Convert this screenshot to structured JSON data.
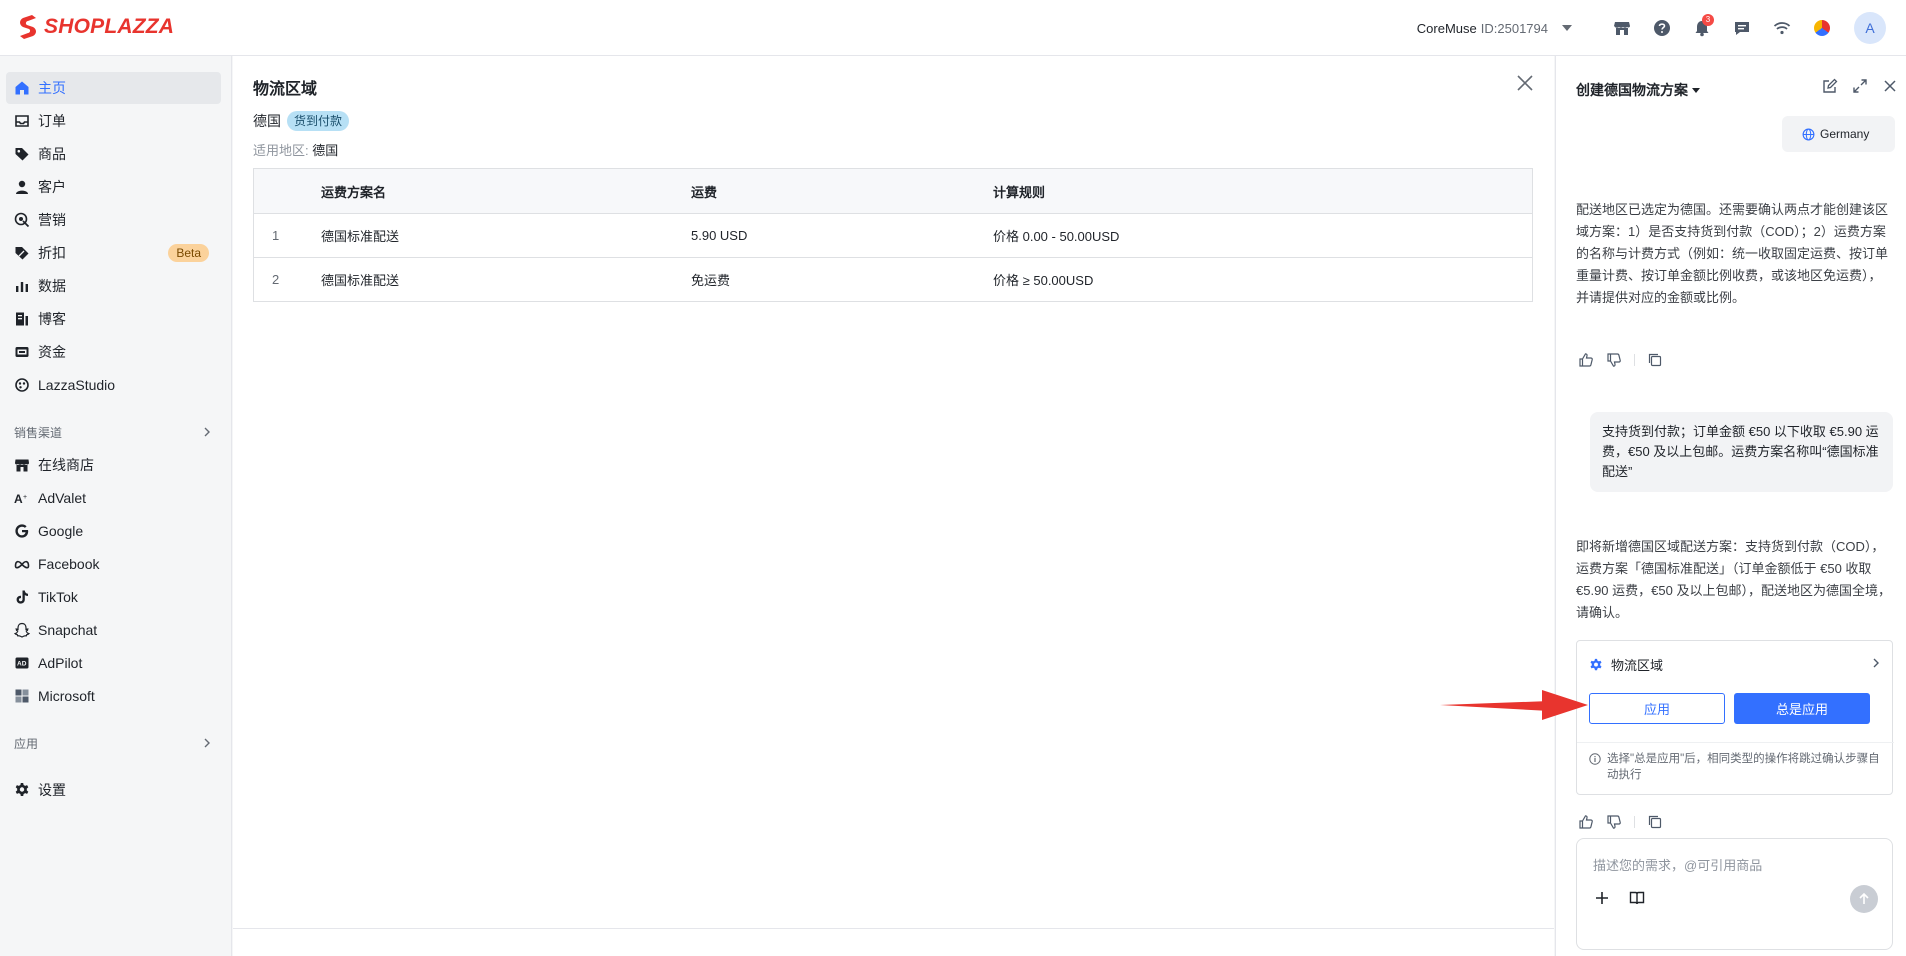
{
  "brand": {
    "logo_text": "SHOPLAZZA",
    "accent": "#3370ff",
    "brand_red": "#e8342e"
  },
  "topbar": {
    "store_name": "CoreMuse",
    "store_id": "ID:2501794",
    "notification_count": "3",
    "avatar_letter": "A",
    "icons": [
      "store-icon",
      "help-icon",
      "bell-icon",
      "message-icon",
      "wifi-icon",
      "color-ball-icon"
    ]
  },
  "sidebar": {
    "items": [
      {
        "label": "主页",
        "icon": "home-icon"
      },
      {
        "label": "订单",
        "icon": "inbox-icon"
      },
      {
        "label": "商品",
        "icon": "tag-icon"
      },
      {
        "label": "客户",
        "icon": "user-icon"
      },
      {
        "label": "营销",
        "icon": "marketing-icon"
      },
      {
        "label": "折扣",
        "icon": "discount-icon"
      },
      {
        "label": "数据",
        "icon": "chart-icon"
      },
      {
        "label": "博客",
        "icon": "blog-icon"
      },
      {
        "label": "资金",
        "icon": "wallet-icon"
      },
      {
        "label": "LazzaStudio",
        "icon": "studio-icon"
      }
    ],
    "beta_label": "Beta",
    "sales_channels_title": "销售渠道",
    "channels": [
      {
        "label": "在线商店",
        "icon": "store-icon"
      },
      {
        "label": "AdValet",
        "icon": "advalet-icon"
      },
      {
        "label": "Google",
        "icon": "google-icon"
      },
      {
        "label": "Facebook",
        "icon": "meta-icon"
      },
      {
        "label": "TikTok",
        "icon": "tiktok-icon"
      },
      {
        "label": "Snapchat",
        "icon": "snapchat-icon"
      },
      {
        "label": "AdPilot",
        "icon": "adpilot-icon"
      },
      {
        "label": "Microsoft",
        "icon": "microsoft-icon"
      }
    ],
    "apps_title": "应用",
    "settings_label": "设置"
  },
  "main": {
    "title": "物流区域",
    "region_name": "德国",
    "cod_tag": "货到付款",
    "applies_label": "适用地区:",
    "applies_value": "德国",
    "table": {
      "headers": [
        "运费方案名",
        "运费",
        "计算规则"
      ],
      "rows": [
        {
          "index": "1",
          "name": "德国标准配送",
          "fee": "5.90 USD",
          "rule": "价格 0.00 - 50.00USD"
        },
        {
          "index": "2",
          "name": "德国标准配送",
          "fee": "免运费",
          "rule": "价格 ≥ 50.00USD"
        }
      ]
    }
  },
  "chat": {
    "title": "创建德国物流方案",
    "country_chip": "Germany",
    "bot_msg_1": "配送地区已选定为德国。还需要确认两点才能创建该区域方案：1）是否支持货到付款（COD）；2）运费方案的名称与计费方式（例如：统一收取固定运费、按订单重量计费、按订单金额比例收费，或该地区免运费），并请提供对应的金额或比例。",
    "user_msg": "支持货到付款；订单金额 €50 以下收取 €5.90 运费，€50 及以上包邮。运费方案名称叫“德国标准配送”",
    "bot_msg_2": "即将新增德国区域配送方案：支持货到付款（COD），运费方案「德国标准配送」（订单金额低于 €50 收取 €5.90 运费，€50 及以上包邮），配送地区为德国全境，请确认。",
    "card": {
      "title": "物流区域",
      "apply_label": "应用",
      "always_apply_label": "总是应用",
      "hint": "选择\"总是应用\"后，相同类型的操作将跳过确认步骤自动执行"
    },
    "input": {
      "placeholder": "描述您的需求，@可引用商品",
      "value": ""
    }
  }
}
